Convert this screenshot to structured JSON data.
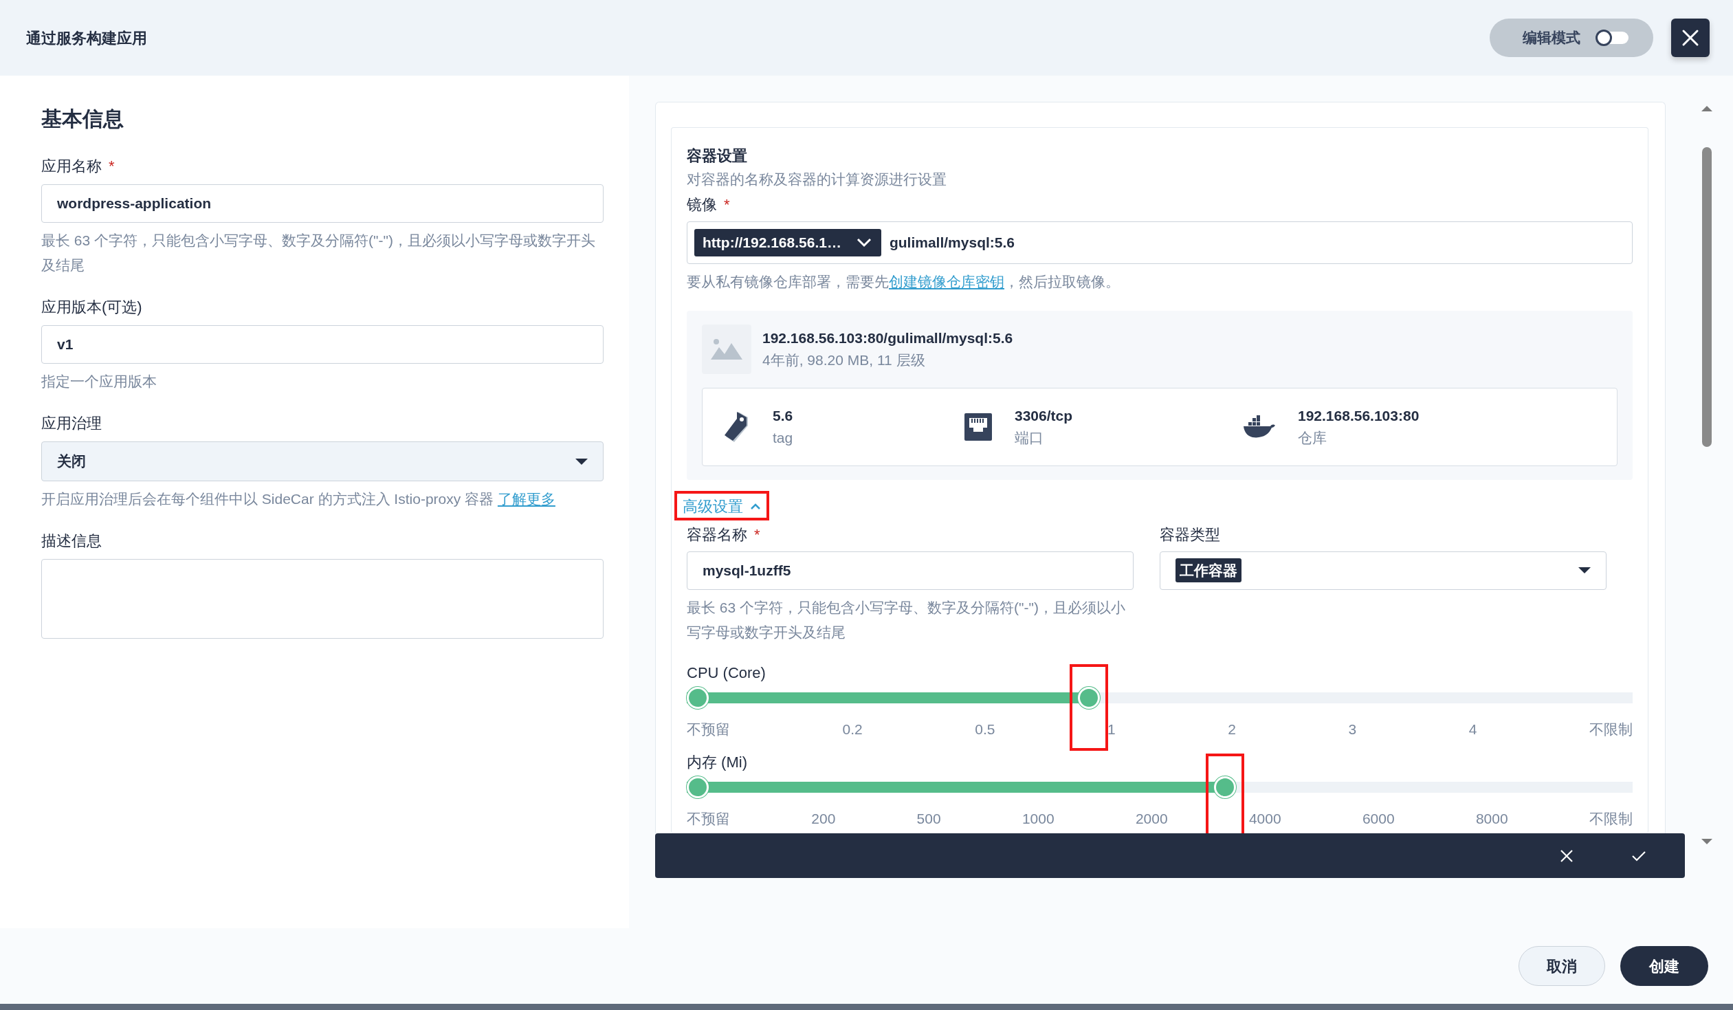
{
  "header": {
    "title": "通过服务构建应用",
    "edit_mode": {
      "label": "编辑模式",
      "on": false
    }
  },
  "basic_info": {
    "heading": "基本信息",
    "fields": [
      {
        "kind": "text",
        "label": "应用名称",
        "required_mark": "*",
        "value": "wordpress-application",
        "help": "最长 63 个字符，只能包含小写字母、数字及分隔符(\"-\")，且必须以小写字母或数字开头及结尾"
      },
      {
        "kind": "text",
        "label": "应用版本(可选)",
        "value": "v1",
        "help": "指定一个应用版本"
      },
      {
        "kind": "select",
        "label": "应用治理",
        "value": "关闭",
        "help": "开启应用治理后会在每个组件中以 SideCar 的方式注入 Istio-proxy 容器",
        "help_link": "了解更多"
      },
      {
        "kind": "textarea",
        "label": "描述信息"
      }
    ]
  },
  "container": {
    "title": "容器设置",
    "description": "对容器的名称及容器的计算资源进行设置",
    "image": {
      "label": "镜像",
      "required_mark": "*",
      "registry": "http://192.168.56.1…",
      "value": "gulimall/mysql:5.6",
      "hint": "要从私有镜像仓库部署，需要先",
      "hint_link": "创建镜像仓库密钥",
      "hint_end": "，然后拉取镜像。"
    },
    "image_info": {
      "name": "192.168.56.103:80/gulimall/mysql:5.6",
      "meta": "4年前, 98.20 MB, 11 层级",
      "details": [
        {
          "kind": "tag",
          "value": "5.6",
          "caption": "tag"
        },
        {
          "kind": "port",
          "value": "3306/tcp",
          "caption": "端口"
        },
        {
          "kind": "registry",
          "value": "192.168.56.103:80",
          "caption": "仓库"
        }
      ]
    },
    "advanced": {
      "label": "高级设置",
      "expanded": true,
      "highlighted": true
    },
    "name_field": {
      "label": "容器名称",
      "required_mark": "*",
      "value": "mysql-1uzff5",
      "help": "最长 63 个字符，只能包含小写字母、数字及分隔符(\"-\")，且必须以小写字母或数字开头及结尾"
    },
    "type_field": {
      "label": "容器类型",
      "value": "工作容器"
    },
    "sliders": [
      {
        "label": "CPU (Core)",
        "level": 0.425,
        "highlighted": true,
        "ticks": [
          "不预留",
          "0.2",
          "0.5",
          "1",
          "2",
          "3",
          "4",
          "不限制"
        ]
      },
      {
        "label": "内存 (Mi)",
        "level": 0.569,
        "highlighted": true,
        "ticks": [
          "不预留",
          "200",
          "500",
          "1000",
          "2000",
          "4000",
          "6000",
          "8000",
          "不限制"
        ]
      }
    ]
  },
  "footer": {
    "cancel": "取消",
    "create": "创建"
  }
}
